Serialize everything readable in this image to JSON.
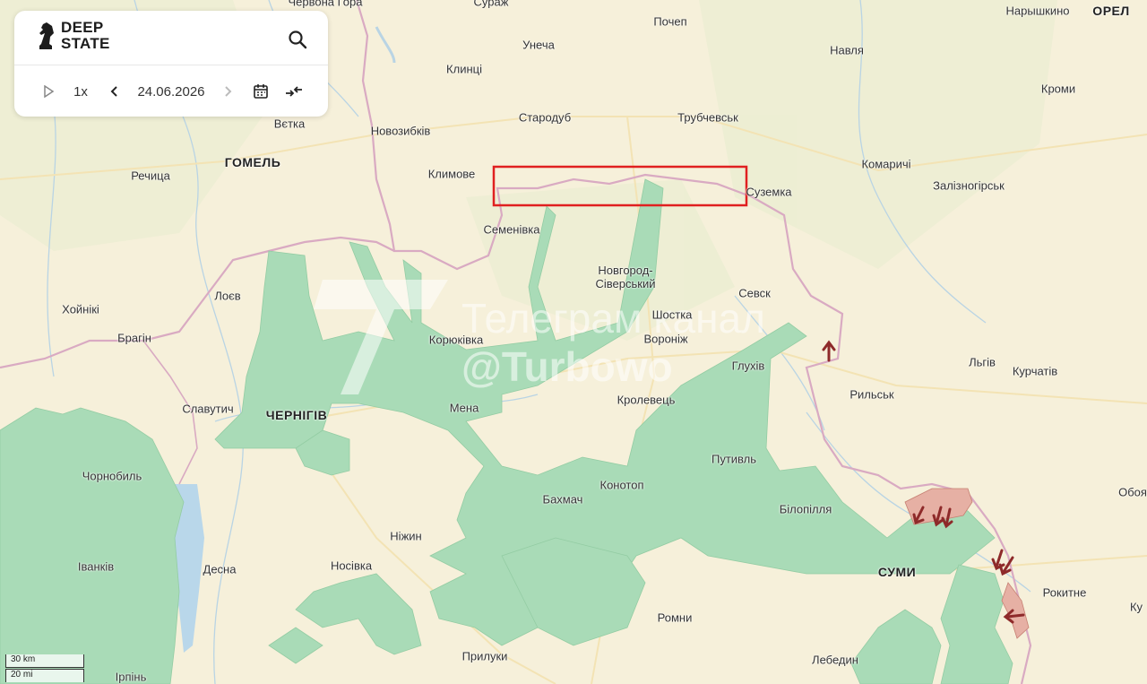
{
  "app": {
    "logo_line1": "DEEP",
    "logo_line2": "STATE"
  },
  "controls": {
    "play_icon": "play-icon",
    "speed": "1x",
    "date": "24.06.2026"
  },
  "colors": {
    "occupied_zone": "#a9dbb7",
    "front_zone": "#e6b0a4",
    "arrow": "#8e2a2a",
    "border": "#d4a8bf",
    "highlight_box": "#e02020"
  },
  "scale": {
    "metric": "30 km",
    "imperial": "20 mi"
  },
  "watermark": {
    "line1": "Телеграм канал",
    "line2": "@Turbowo"
  },
  "places": [
    {
      "id": "chervona-hora",
      "name": "Червона Гора",
      "cls": ""
    },
    {
      "id": "surazh",
      "name": "Сураж",
      "cls": ""
    },
    {
      "id": "pochep",
      "name": "Почеп",
      "cls": ""
    },
    {
      "id": "naryshkino",
      "name": "Нарышкино",
      "cls": ""
    },
    {
      "id": "orel",
      "name": "ОРЕЛ",
      "cls": "city"
    },
    {
      "id": "unecha",
      "name": "Унеча",
      "cls": ""
    },
    {
      "id": "navlia",
      "name": "Навля",
      "cls": ""
    },
    {
      "id": "klintsy",
      "name": "Клинці",
      "cls": ""
    },
    {
      "id": "kromy",
      "name": "Кроми",
      "cls": ""
    },
    {
      "id": "starodub",
      "name": "Стародуб",
      "cls": ""
    },
    {
      "id": "trubchevsk",
      "name": "Трубчевськ",
      "cls": ""
    },
    {
      "id": "vietka",
      "name": "Вєтка",
      "cls": ""
    },
    {
      "id": "novozybkiv",
      "name": "Новозибків",
      "cls": ""
    },
    {
      "id": "homel",
      "name": "ГОМЕЛЬ",
      "cls": "city"
    },
    {
      "id": "rechytsa",
      "name": "Речица",
      "cls": ""
    },
    {
      "id": "klymove",
      "name": "Климове",
      "cls": ""
    },
    {
      "id": "komarychi",
      "name": "Комаричі",
      "cls": ""
    },
    {
      "id": "zaliznohirsk",
      "name": "Залізногірськ",
      "cls": ""
    },
    {
      "id": "suzemka",
      "name": "Суземка",
      "cls": ""
    },
    {
      "id": "semenivka",
      "name": "Семенівка",
      "cls": ""
    },
    {
      "id": "novhorod",
      "name": "Новгород-\nСіверський",
      "cls": "two"
    },
    {
      "id": "loiev",
      "name": "Лоєв",
      "cls": ""
    },
    {
      "id": "sevsk",
      "name": "Севск",
      "cls": ""
    },
    {
      "id": "khoiniki",
      "name": "Хойнікі",
      "cls": ""
    },
    {
      "id": "shostka",
      "name": "Шостка",
      "cls": ""
    },
    {
      "id": "brahin",
      "name": "Брагін",
      "cls": ""
    },
    {
      "id": "koriukivka",
      "name": "Корюківка",
      "cls": ""
    },
    {
      "id": "voronizh",
      "name": "Вороніж",
      "cls": ""
    },
    {
      "id": "lhov",
      "name": "Льгів",
      "cls": ""
    },
    {
      "id": "kurchatov",
      "name": "Курчатів",
      "cls": ""
    },
    {
      "id": "hlukhiv",
      "name": "Глухів",
      "cls": ""
    },
    {
      "id": "rylsk",
      "name": "Рильськ",
      "cls": ""
    },
    {
      "id": "krolevets",
      "name": "Кролевець",
      "cls": ""
    },
    {
      "id": "slavutych",
      "name": "Славутич",
      "cls": ""
    },
    {
      "id": "chernihiv",
      "name": "ЧЕРНІГІВ",
      "cls": "city"
    },
    {
      "id": "mena",
      "name": "Мена",
      "cls": ""
    },
    {
      "id": "putyvl",
      "name": "Путивль",
      "cls": ""
    },
    {
      "id": "chornobyl",
      "name": "Чорнобиль",
      "cls": ""
    },
    {
      "id": "konotop",
      "name": "Конотоп",
      "cls": ""
    },
    {
      "id": "oboian",
      "name": "Обоя",
      "cls": ""
    },
    {
      "id": "bakhmach",
      "name": "Бахмач",
      "cls": ""
    },
    {
      "id": "bilopillia",
      "name": "Білопілля",
      "cls": ""
    },
    {
      "id": "nizhyn",
      "name": "Ніжин",
      "cls": ""
    },
    {
      "id": "ivankiv",
      "name": "Іванків",
      "cls": ""
    },
    {
      "id": "desna",
      "name": "Десна",
      "cls": ""
    },
    {
      "id": "nosivka",
      "name": "Носівка",
      "cls": ""
    },
    {
      "id": "sumy",
      "name": "СУМИ",
      "cls": "city"
    },
    {
      "id": "rokytne",
      "name": "Рокитне",
      "cls": ""
    },
    {
      "id": "romny",
      "name": "Ромни",
      "cls": ""
    },
    {
      "id": "pryluky",
      "name": "Прилуки",
      "cls": ""
    },
    {
      "id": "lebedyn",
      "name": "Лебедин",
      "cls": ""
    },
    {
      "id": "irpin",
      "name": "Ірпінь",
      "cls": ""
    },
    {
      "id": "ku",
      "name": "Ку",
      "cls": ""
    }
  ]
}
